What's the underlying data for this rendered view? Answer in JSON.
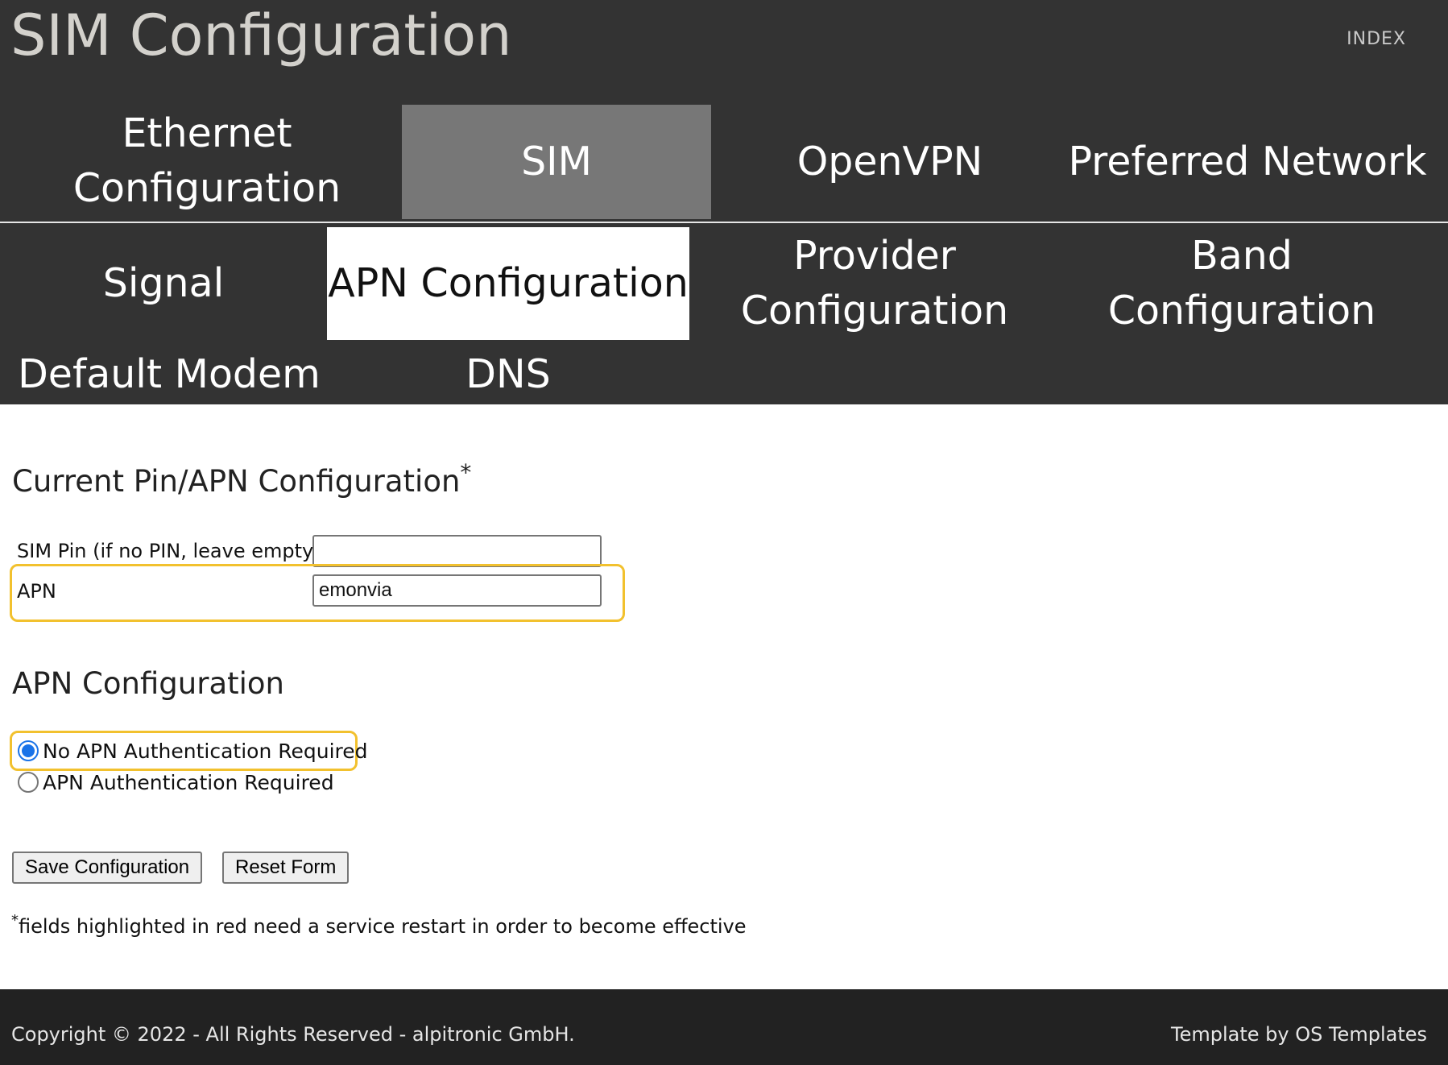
{
  "header": {
    "title": "SIM Configuration",
    "index_link": "INDEX"
  },
  "nav_main": [
    {
      "label_line1": "Ethernet",
      "label_line2": "Configuration",
      "active": false
    },
    {
      "label": "SIM",
      "active": true
    },
    {
      "label": "OpenVPN",
      "active": false
    },
    {
      "label": "Preferred Network",
      "active": false
    }
  ],
  "nav_sub": [
    {
      "label": "Signal",
      "active": false
    },
    {
      "label": "APN Configuration",
      "active": true
    },
    {
      "label_line1": "Provider",
      "label_line2": "Configuration",
      "active": false
    },
    {
      "label_line1": "Band",
      "label_line2": "Configuration",
      "active": false
    },
    {
      "label": "Default Modem",
      "active": false
    },
    {
      "label": "DNS",
      "active": false
    }
  ],
  "pin_section": {
    "title": "Current Pin/APN Configuration",
    "title_marker": "*",
    "sim_pin_label": "SIM Pin (if no PIN, leave empty)",
    "sim_pin_value": "",
    "apn_label": "APN",
    "apn_value": "emonvia"
  },
  "apn_section": {
    "title": "APN Configuration",
    "options": [
      {
        "label": "No APN Authentication Required",
        "selected": true
      },
      {
        "label": "APN Authentication Required",
        "selected": false
      }
    ]
  },
  "buttons": {
    "save": "Save Configuration",
    "reset": "Reset Form"
  },
  "footnote": {
    "marker": "*",
    "text": "fields highlighted in red need a service restart in order to become effective"
  },
  "footer": {
    "copyright": "Copyright © 2022 - All Rights Reserved - alpitronic GmbH.",
    "template_credit": "Template by OS Templates"
  },
  "colors": {
    "header_bg": "#333333",
    "active_tab_bg": "#777777",
    "highlight": "#f2c12e",
    "footer_bg": "#222222",
    "radio_accent": "#1a73e8"
  }
}
